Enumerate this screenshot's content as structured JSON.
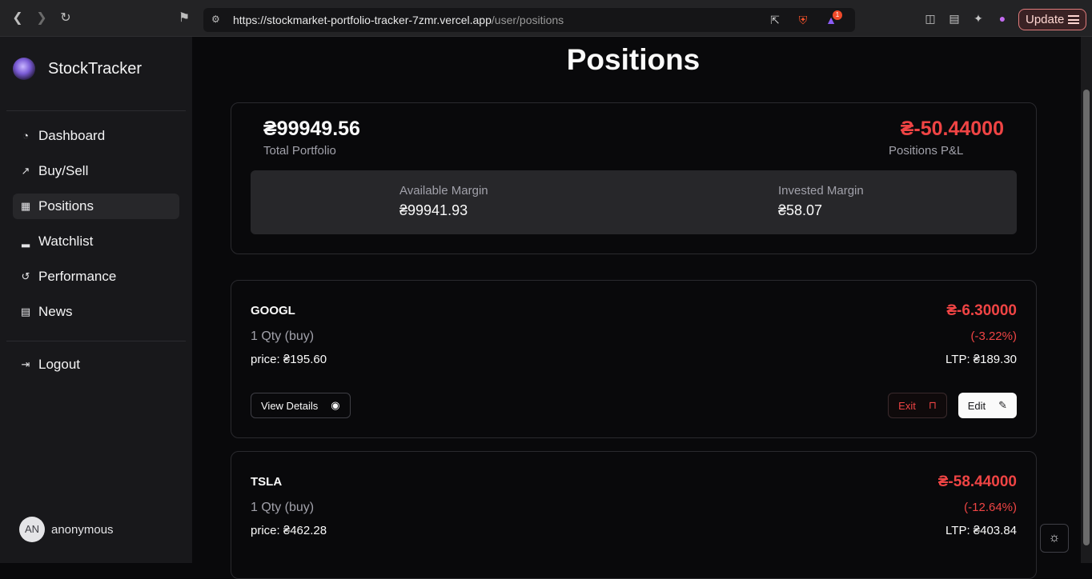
{
  "browser": {
    "url_host": "https://stockmarket-portfolio-tracker-7zmr.vercel.app",
    "url_path": "/user/positions",
    "update_label": "Update",
    "badge_count": "1"
  },
  "sidebar": {
    "brand": "StockTracker",
    "items": [
      {
        "label": "Dashboard",
        "icon": "gauge-icon"
      },
      {
        "label": "Buy/Sell",
        "icon": "trending-up-icon"
      },
      {
        "label": "Positions",
        "icon": "chart-icon"
      },
      {
        "label": "Watchlist",
        "icon": "bar-chart-icon"
      },
      {
        "label": "Performance",
        "icon": "history-icon"
      },
      {
        "label": "News",
        "icon": "newspaper-icon"
      }
    ],
    "logout": "Logout",
    "user_initials": "AN",
    "user_name": "anonymous"
  },
  "page": {
    "title": "Positions"
  },
  "summary": {
    "total_value": "₴99949.56",
    "total_label": "Total Portfolio",
    "pnl_value": "₴-50.44000",
    "pnl_label": "Positions P&L",
    "available_label": "Available Margin",
    "available_value": "₴99941.93",
    "invested_label": "Invested Margin",
    "invested_value": "₴58.07"
  },
  "positions": [
    {
      "symbol": "GOOGL",
      "qty": "1 Qty (buy)",
      "price": "price: ₴195.60",
      "pnl": "₴-6.30000",
      "pct": "(-3.22%)",
      "ltp": "LTP: ₴189.30",
      "view": "View Details",
      "exit": "Exit",
      "edit": "Edit"
    },
    {
      "symbol": "TSLA",
      "qty": "1 Qty (buy)",
      "price": "price: ₴462.28",
      "pnl": "₴-58.44000",
      "pct": "(-12.64%)",
      "ltp": "LTP: ₴403.84"
    }
  ],
  "colors": {
    "loss": "#ef4444",
    "background": "#09090b",
    "sidebar": "#18181b"
  }
}
